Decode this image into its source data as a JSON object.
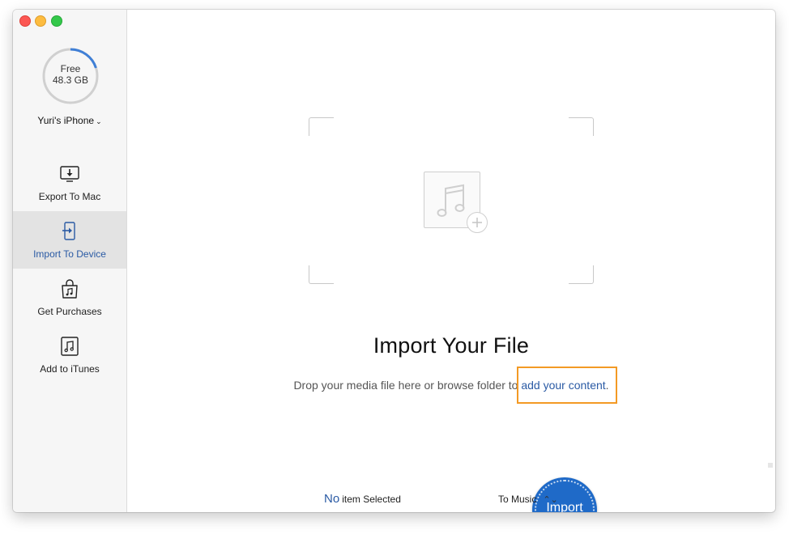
{
  "window": {
    "traffic_lights": [
      "close",
      "minimize",
      "maximize"
    ],
    "colors": {
      "close": "#fc5753",
      "minimize": "#fdbc40",
      "maximize": "#34c84a"
    }
  },
  "sidebar": {
    "storage": {
      "line1": "Free",
      "line2": "48.3 GB",
      "used_fraction": 0.2,
      "ring_color": "#3f7fd6"
    },
    "device": {
      "name": "Yuri's iPhone",
      "chevron": "⌄"
    },
    "items": [
      {
        "label": "Export To Mac",
        "icon": "export-to-mac-icon",
        "active": false
      },
      {
        "label": "Import To Device",
        "icon": "import-to-device-icon",
        "active": true
      },
      {
        "label": "Get Purchases",
        "icon": "shopping-bag-icon",
        "active": false
      },
      {
        "label": "Add to iTunes",
        "icon": "music-note-icon",
        "active": false
      }
    ]
  },
  "main": {
    "drop_zone": {
      "icon": "music-note-icon",
      "badge_icon": "plus-icon"
    },
    "title": "Import Your File",
    "subtitle_prefix": "Drop your media file here or browse folder to ",
    "subtitle_link": "add your content",
    "subtitle_suffix": ".",
    "highlight_color": "#f39a24",
    "link_color": "#2a5aa4"
  },
  "footer": {
    "selected_count": "No",
    "selected_label": "item Selected",
    "import_label": "Import",
    "import_color": "#1f6ac8",
    "destination": "To Music",
    "destination_icon": "up-down-arrows-icon",
    "destination_glyph": "⌃⌄"
  }
}
